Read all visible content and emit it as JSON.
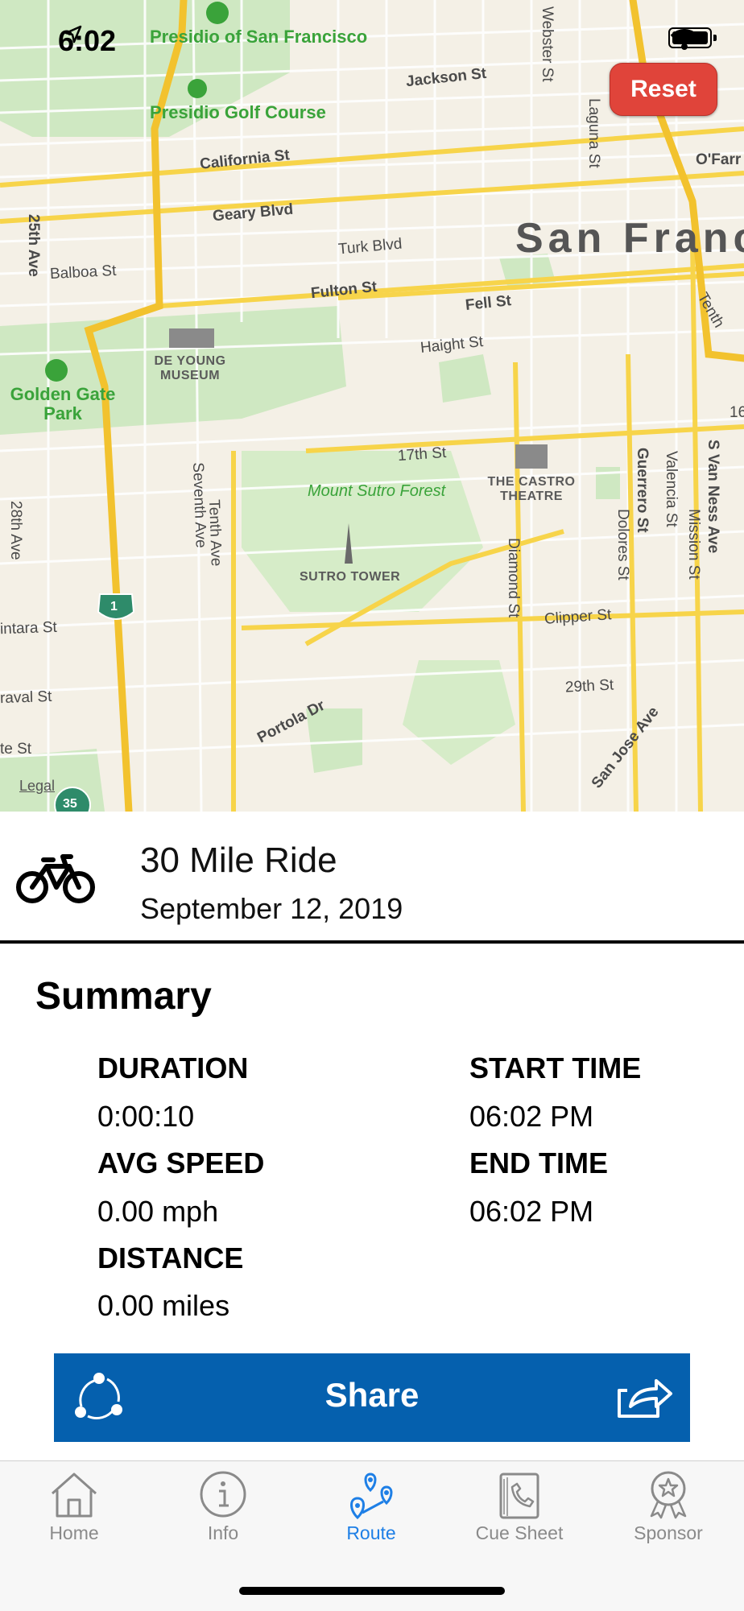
{
  "status_bar": {
    "time": "6:02"
  },
  "map": {
    "reset_label": "Reset",
    "labels": {
      "presidio": "Presidio of San Francisco",
      "presidio_golf": "Presidio Golf Course",
      "golden_gate_park": "Golden Gate Park",
      "de_young": "DE YOUNG MUSEUM",
      "mount_sutro": "Mount Sutro Forest",
      "sutro_tower": "SUTRO TOWER",
      "castro_theatre": "THE CASTRO THEATRE",
      "city": "San Franc",
      "legal": "Legal",
      "jackson": "Jackson St",
      "california": "California St",
      "geary": "Geary Blvd",
      "turk": "Turk Blvd",
      "balboa": "Balboa St",
      "fulton": "Fulton St",
      "fell": "Fell St",
      "haight": "Haight St",
      "seventeenth": "17th St",
      "clipper": "Clipper St",
      "twentyninth": "29th St",
      "portola": "Portola Dr",
      "san_jose": "San Jose Ave",
      "seventh_ave": "Seventh Ave",
      "tenth_ave": "Tenth Ave",
      "diamond": "Diamond St",
      "dolores": "Dolores St",
      "guerrero": "Guerrero St",
      "valencia": "Valencia St",
      "mission": "Mission St",
      "van_ness": "S Van Ness Ave",
      "webster": "Webster St",
      "laguna": "Laguna St",
      "ofarrell": "O'Farr",
      "twentyfifth": "25th Ave",
      "twentyeighth": "28th Ave",
      "quintara": "intara St",
      "taraval": "raval St",
      "vicente": "te St",
      "tenth": "Tenth",
      "route_1": "1",
      "route_35": "35",
      "sixteen": "16"
    }
  },
  "ride": {
    "title": "30 Mile Ride",
    "date": "September 12, 2019"
  },
  "summary": {
    "heading": "Summary",
    "duration_label": "DURATION",
    "duration_value": "0:00:10",
    "avg_speed_label": "AVG SPEED",
    "avg_speed_value": "0.00 mph",
    "distance_label": "DISTANCE",
    "distance_value": "0.00 miles",
    "start_time_label": "START TIME",
    "start_time_value": "06:02 PM",
    "end_time_label": "END TIME",
    "end_time_value": "06:02 PM"
  },
  "share": {
    "label": "Share"
  },
  "tabs": [
    {
      "label": "Home",
      "icon": "home-icon"
    },
    {
      "label": "Info",
      "icon": "info-icon"
    },
    {
      "label": "Route",
      "icon": "route-icon",
      "active": true
    },
    {
      "label": "Cue Sheet",
      "icon": "cue-sheet-icon"
    },
    {
      "label": "Sponsor",
      "icon": "sponsor-icon"
    }
  ],
  "colors": {
    "accent": "#1e7fe6",
    "share_background": "#0560ae",
    "reset_background": "#e0443a",
    "park_green": "#c5e6b5",
    "highway_yellow": "#f7d44a"
  }
}
